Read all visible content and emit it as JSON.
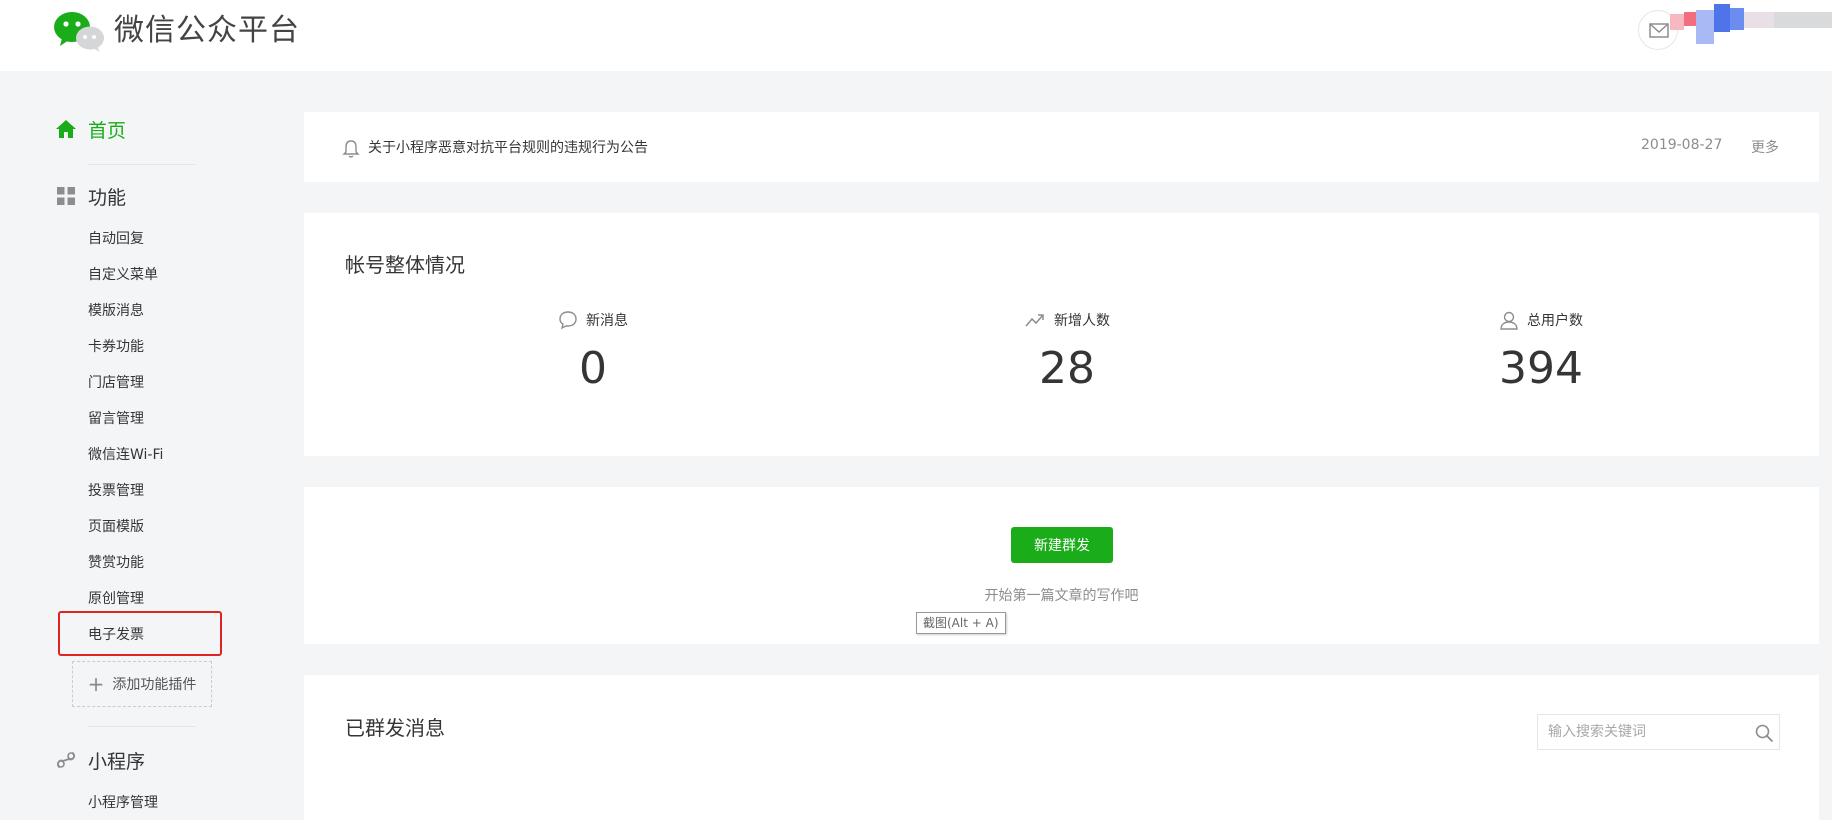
{
  "header": {
    "logo_text": "微信公众平台"
  },
  "sidebar": {
    "home_label": "首页",
    "function_label": "功能",
    "function_items": [
      "自动回复",
      "自定义菜单",
      "模版消息",
      "卡券功能",
      "门店管理",
      "留言管理",
      "微信连Wi-Fi",
      "投票管理",
      "页面模版",
      "赞赏功能",
      "原创管理",
      "电子发票"
    ],
    "add_plugin_label": "添加功能插件",
    "mini_program_label": "小程序",
    "mini_program_items": [
      "小程序管理"
    ],
    "highlighted_item": "电子发票"
  },
  "notice": {
    "text": "关于小程序恶意对抗平台规则的违规行为公告",
    "date": "2019-08-27",
    "more": "更多"
  },
  "overview": {
    "title": "帐号整体情况",
    "stats": [
      {
        "label": "新消息",
        "value": "0",
        "icon": "chat-bubble-icon"
      },
      {
        "label": "新增人数",
        "value": "28",
        "icon": "trend-up-icon"
      },
      {
        "label": "总用户数",
        "value": "394",
        "icon": "user-icon"
      }
    ]
  },
  "compose": {
    "button_label": "新建群发",
    "hint": "开始第一篇文章的写作吧",
    "tooltip": "截图(Alt + A)"
  },
  "sent": {
    "title": "已群发消息",
    "search_placeholder": "输入搜索关键词"
  },
  "colors": {
    "accent": "#1aad19",
    "highlight_border": "#e02424",
    "background": "#f4f5f7"
  }
}
